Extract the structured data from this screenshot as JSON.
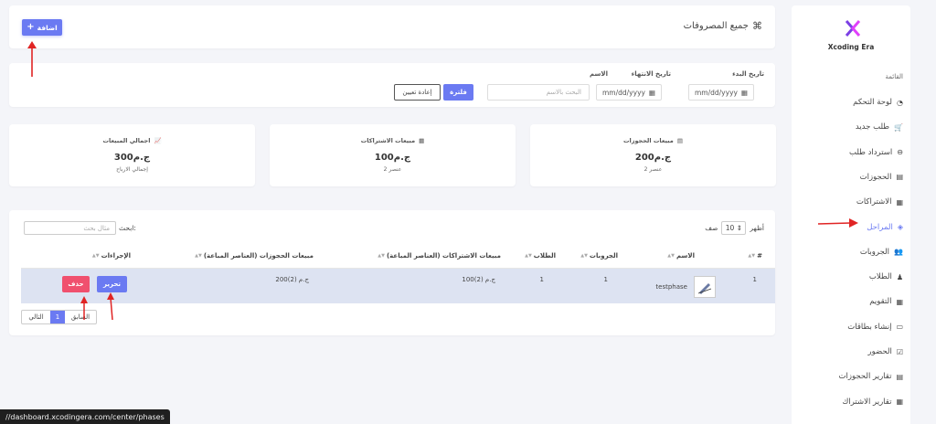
{
  "sidebar": {
    "brand": "Xcoding Era",
    "menu_heading": "القائمة",
    "items": [
      {
        "label": "لوحة التحكم",
        "icon": "dashboard-icon"
      },
      {
        "label": "طلب جديد",
        "icon": "cart-icon"
      },
      {
        "label": "استرداد طلب",
        "icon": "minus-circle-icon"
      },
      {
        "label": "الحجوزات",
        "icon": "book-icon"
      },
      {
        "label": "الاشتراكات",
        "icon": "calendar-icon"
      },
      {
        "label": "المراحل",
        "icon": "layers-icon",
        "active": true
      },
      {
        "label": "الجروبات",
        "icon": "users-icon"
      },
      {
        "label": "الطلاب",
        "icon": "student-icon"
      },
      {
        "label": "التقويم",
        "icon": "calendar-icon"
      },
      {
        "label": "إنشاء بطاقات",
        "icon": "id-card-icon"
      },
      {
        "label": "الحضور",
        "icon": "check-square-icon"
      },
      {
        "label": "تقارير الحجوزات",
        "icon": "book-icon"
      },
      {
        "label": "تقارير الاشتراك",
        "icon": "calendar-icon"
      }
    ]
  },
  "header": {
    "title": "جميع المصروفات",
    "add_label": "اضافة",
    "add_icon": "plus-icon"
  },
  "filter": {
    "start_label": "تاريخ البدء",
    "end_label": "تاريخ الانتهاء",
    "name_label": "الاسم",
    "date_placeholder": "mm/dd/yyyy",
    "name_placeholder": "البحث بالاسم",
    "filter_label": "فلترة",
    "reset_label": "إعادة تعيين"
  },
  "stats": [
    {
      "title": "مبيعات الحجوزات",
      "value": "200ج.م",
      "sub": "2 عنصر",
      "icon": "book-icon"
    },
    {
      "title": "مبيعات الاشتراكات",
      "value": "100ج.م",
      "sub": "2 عنصر",
      "icon": "calendar-icon"
    },
    {
      "title": "اجمالي المبيعات",
      "value": "300ج.م",
      "sub": "إجمالي الارباح",
      "icon": "chart-line-icon"
    }
  ],
  "table": {
    "show_label": "أظهر",
    "show_value": "10",
    "rows_label": "صف",
    "search_label": "ابحث:",
    "search_placeholder": "مثال بحث",
    "headers": [
      "#",
      "الاسم",
      "الجروبات",
      "الطلاب",
      "مبيعات الاشتراكات (العناصر المباعة)",
      "مبيعات الحجوزات (العناصر المباعة)",
      "الإجراءات"
    ],
    "rows": [
      {
        "num": "1",
        "name": "testphase",
        "groups": "1",
        "students": "1",
        "subs_sales": "100ج.م (2)",
        "bookings_sales": "200ج.م (2)"
      }
    ],
    "edit_label": "تحرير",
    "delete_label": "حذف",
    "pager": {
      "next": "التالي",
      "current": "1",
      "prev": "السابق"
    }
  },
  "statusbar": {
    "url": "//dashboard.xcodingera.com/center/phases"
  },
  "colors": {
    "accent": "#6b7af2",
    "danger": "#f0506e",
    "arrow": "#e02424"
  }
}
